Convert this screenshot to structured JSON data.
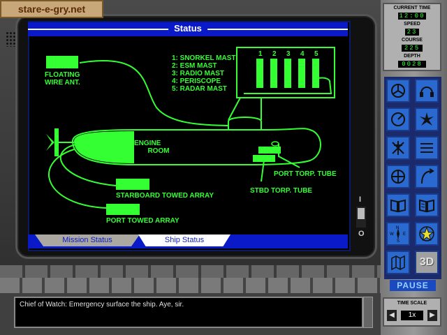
{
  "watermark": "stare-e-gry.net",
  "screen": {
    "title": "Status",
    "tabs": [
      {
        "label": "Mission Status"
      },
      {
        "label": "Ship Status"
      }
    ],
    "diagram": {
      "floating_wire_ant": "FLOATING\nWIRE ANT.",
      "mast_list": "1: SNORKEL MAST\n2: ESM MAST\n3: RADIO MAST\n4: PERISCOPE\n5: RADAR MAST",
      "mast_numbers": [
        "1",
        "2",
        "3",
        "4",
        "5"
      ],
      "engine_room": "ENGINE\n       ROOM",
      "port_torp_tube": "PORT TORP. TUBE",
      "stbd_torp_tube": "STBD TORP. TUBE",
      "starboard_towed_array": "STARBOARD TOWED ARRAY",
      "port_towed_array": "PORT TOWED ARRAY"
    }
  },
  "message": "Chief of Watch:  Emergency surface the ship.  Aye, sir.",
  "status": {
    "current_time_label": "CURRENT TIME",
    "current_time": "12:00",
    "speed_label": "SPEED",
    "speed": "23",
    "course_label": "COURSE",
    "course": "225",
    "depth_label": "DEPTH",
    "depth": "0028"
  },
  "buttons": [
    {
      "icon": "helm-wheel-icon"
    },
    {
      "icon": "headphones-icon"
    },
    {
      "icon": "gauge-icon"
    },
    {
      "icon": "explosion-icon"
    },
    {
      "icon": "mast-icon"
    },
    {
      "icon": "list-lines-icon"
    },
    {
      "icon": "crosshair-icon"
    },
    {
      "icon": "curve-arrow-icon"
    },
    {
      "icon": "book-icon"
    },
    {
      "icon": "book-alt-icon"
    },
    {
      "icon": "compass-rose-icon"
    },
    {
      "icon": "star-icon"
    },
    {
      "icon": "map-icon"
    },
    {
      "icon": "3d-icon",
      "label": "3D"
    }
  ],
  "compass": {
    "n": "N",
    "w": "W",
    "e": "E",
    "s": "S"
  },
  "pause_label": "PAUSE",
  "time_scale": {
    "label": "TIME SCALE",
    "value": "1x"
  },
  "toggle": {
    "on": "I",
    "off": "O"
  },
  "colors": {
    "diagram_green": "#33ff33",
    "title_blue": "#0a1ac8",
    "button_blue": "#2a6ad0"
  }
}
